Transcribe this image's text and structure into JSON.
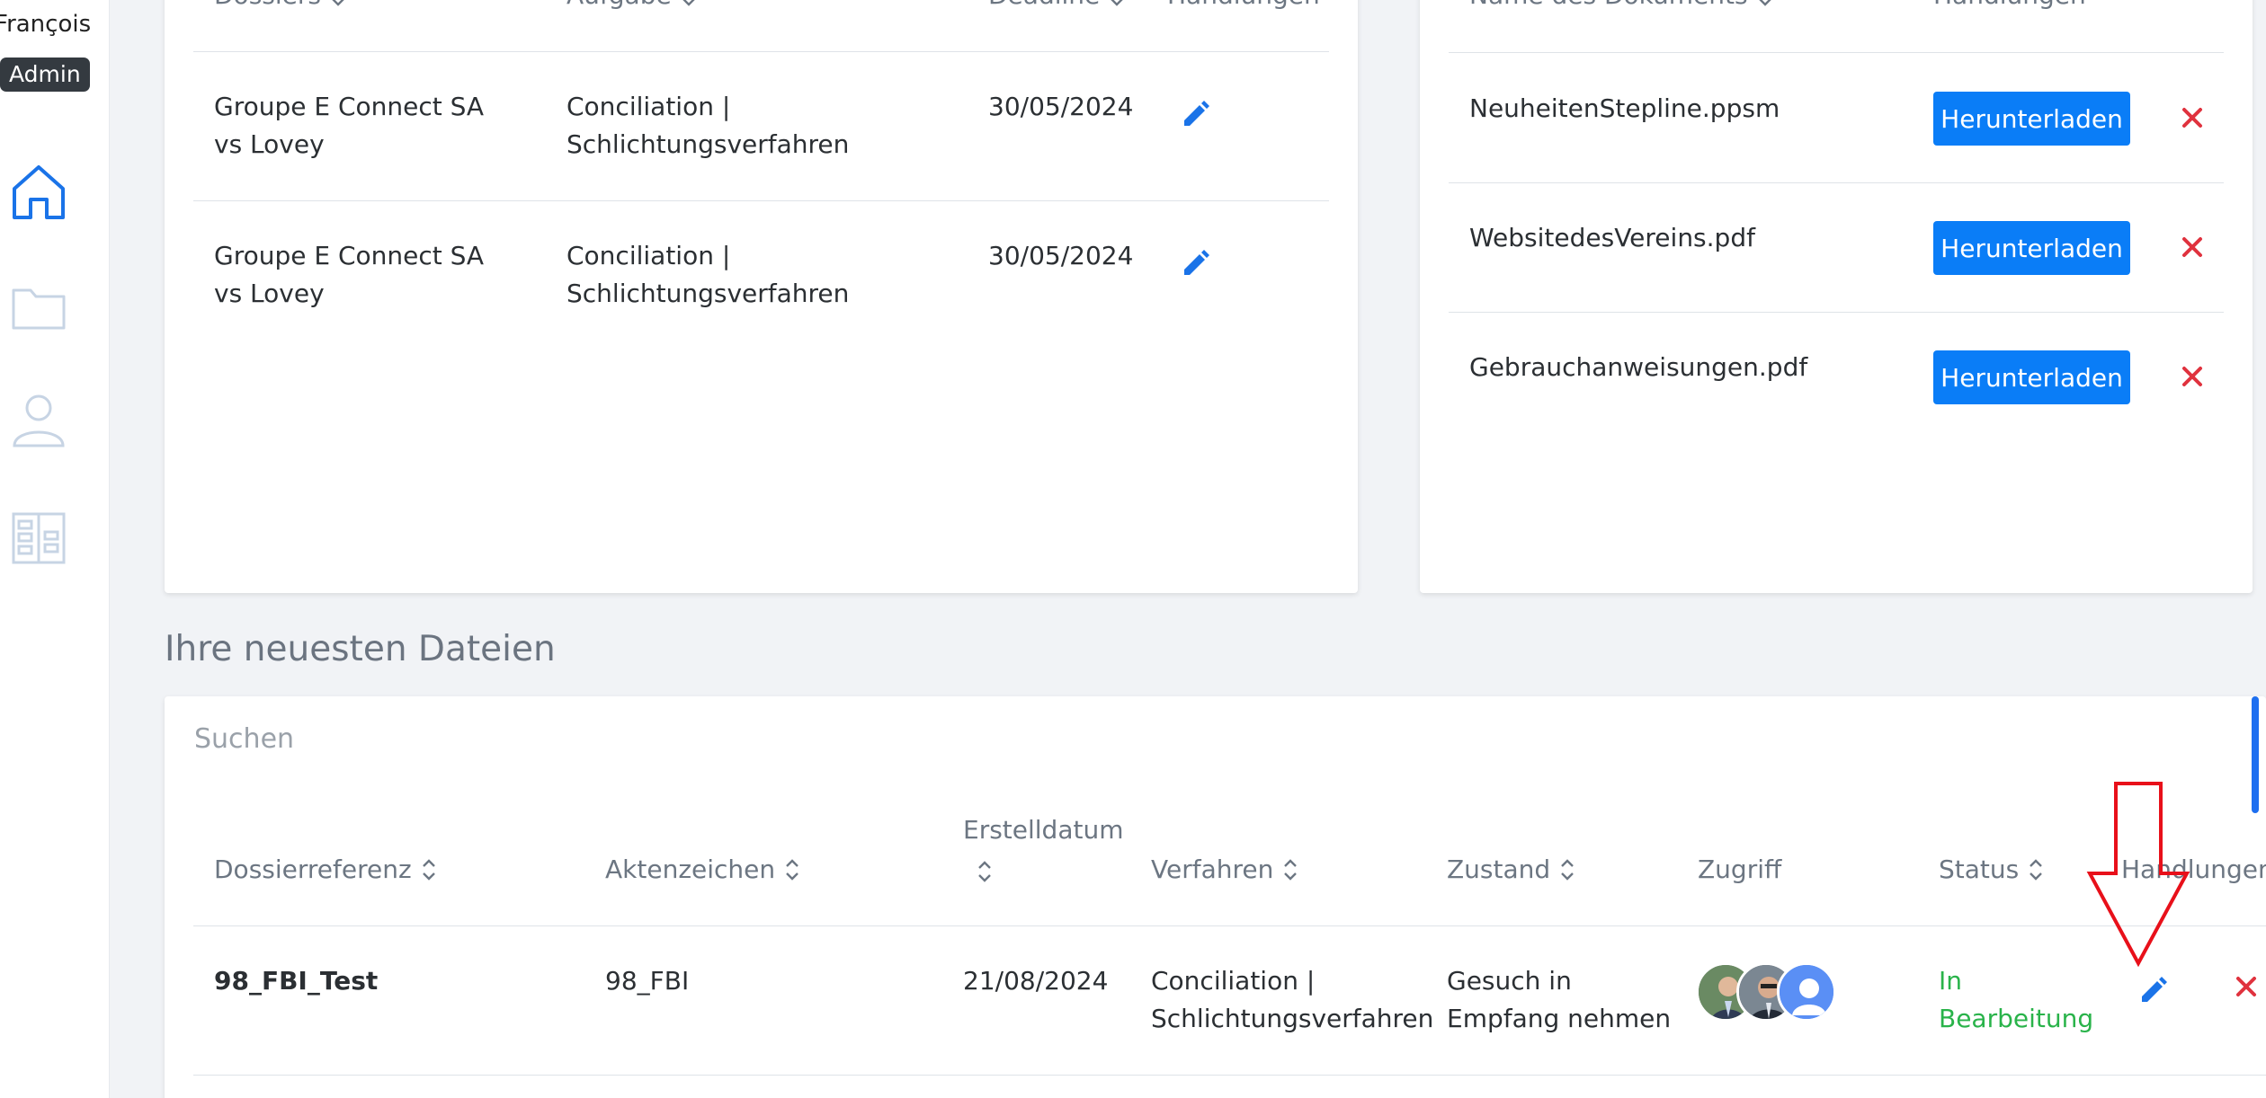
{
  "sidebar": {
    "user_name": "François",
    "role": "Admin",
    "nav_icons": [
      "home-icon",
      "folder-icon",
      "user-icon",
      "building-icon"
    ]
  },
  "tasks": {
    "headers": [
      "Dossiers",
      "Aufgabe",
      "Deadline",
      "Handlungen"
    ],
    "rows": [
      {
        "dossier": "Groupe E Connect SA vs Lovey",
        "task_line1": "Conciliation |",
        "task_line2": "Schlichtungsverfahren",
        "deadline": "30/05/2024"
      },
      {
        "dossier": "Groupe E Connect SA vs Lovey",
        "task_line1": "Conciliation |",
        "task_line2": "Schlichtungsverfahren",
        "deadline": "30/05/2024"
      }
    ]
  },
  "documents": {
    "headers": [
      "Name des Dokuments",
      "Handlungen"
    ],
    "download_label": "Herunterladen",
    "rows": [
      {
        "name": "NeuheitenStepline.ppsm"
      },
      {
        "name": "WebsitedesVereins.pdf"
      },
      {
        "name": "Gebrauchanweisungen.pdf"
      }
    ]
  },
  "files": {
    "title": "Ihre neuesten Dateien",
    "search_placeholder": "Suchen",
    "headers": {
      "reference": "Dossierreferenz",
      "file_number": "Aktenzeichen",
      "created_line1": "Erstelldatum",
      "procedure": "Verfahren",
      "state": "Zustand",
      "access": "Zugriff",
      "status": "Status",
      "actions": "Handlungen"
    },
    "rows": [
      {
        "reference": "98_FBI_Test",
        "file_number": "98_FBI",
        "created": "21/08/2024",
        "procedure_line1": "Conciliation |",
        "procedure_line2": "Schlichtungsverfahren",
        "state_line1": "Gesuch in",
        "state_line2": "Empfang nehmen",
        "status_line1": "In",
        "status_line2": "Bearbeitung"
      }
    ]
  },
  "colors": {
    "primary": "#0a7df7",
    "danger": "#e0323e",
    "status_green": "#29b34a",
    "annotation_red": "#e8101a"
  }
}
